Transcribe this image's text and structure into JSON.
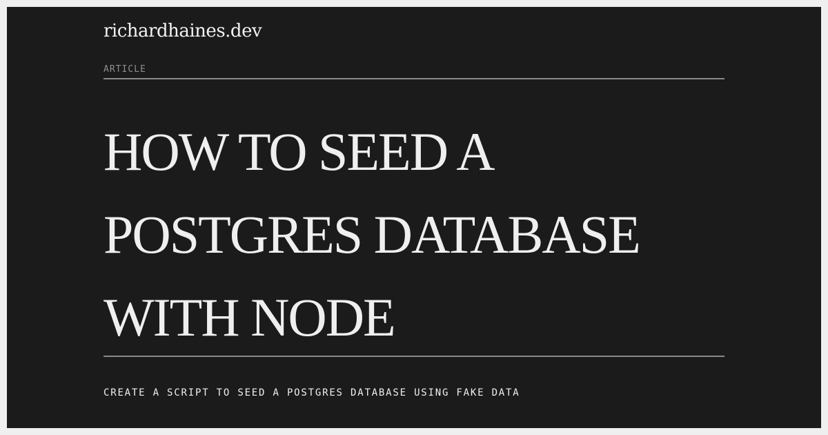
{
  "site": {
    "name": "richardhaines.dev"
  },
  "article": {
    "category": "ARTICLE",
    "title_lines": [
      "HOW TO SEED A",
      "POSTGRES DATABASE",
      "WITH NODE"
    ],
    "subtitle": "CREATE A SCRIPT TO SEED A POSTGRES DATABASE USING FAKE DATA"
  },
  "colors": {
    "background": "#1b1b1b",
    "border": "#efefef",
    "text": "#efefef",
    "muted": "#8e8e8e",
    "rule": "#8a8a8a"
  }
}
